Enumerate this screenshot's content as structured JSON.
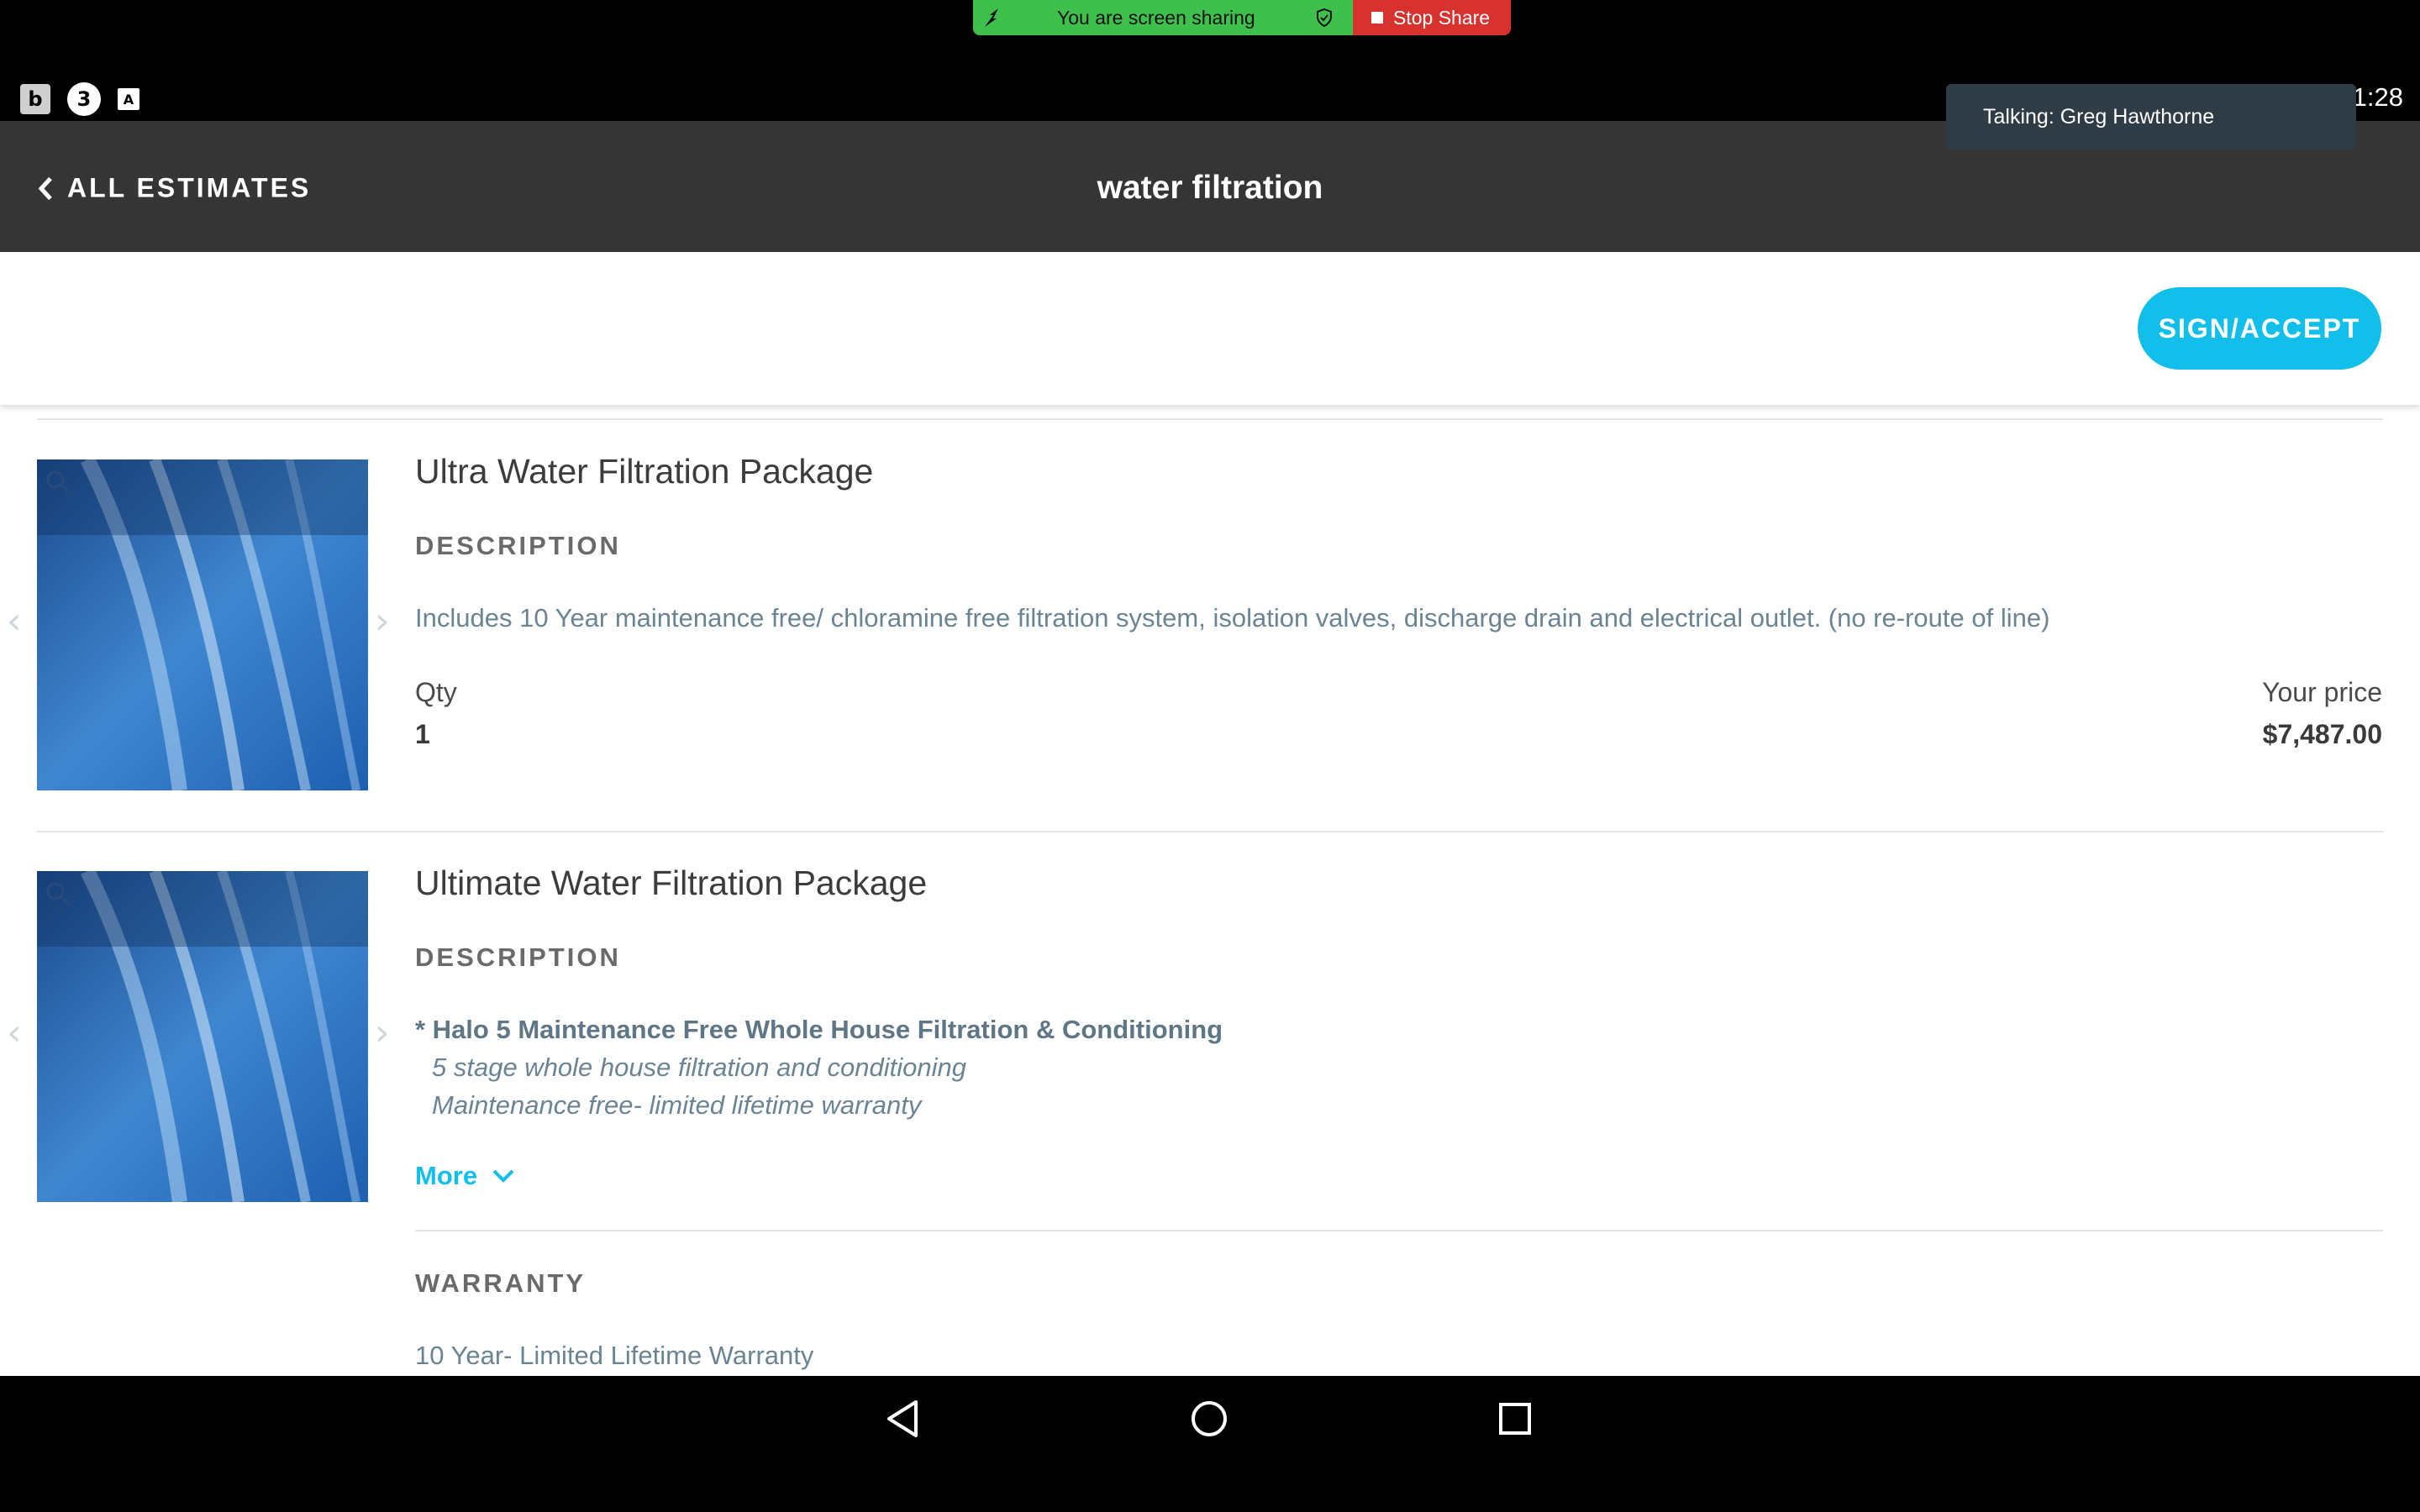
{
  "screen_share": {
    "status_text": "You are screen sharing",
    "stop_label": "Stop Share"
  },
  "status_bar": {
    "icons": [
      "b",
      "3",
      "A"
    ],
    "clock": "1:28"
  },
  "talking_toast": "Talking: Greg Hawthorne",
  "header": {
    "back_label": "ALL ESTIMATES",
    "title": "water filtration"
  },
  "actions": {
    "sign_label": "SIGN/ACCEPT"
  },
  "items": [
    {
      "title": "Ultra Water Filtration Package",
      "description_label": "DESCRIPTION",
      "description": "Includes 10 Year maintenance free/ chloramine free filtration system, isolation valves, discharge drain and electrical outlet. (no re-route of line)",
      "qty_label": "Qty",
      "qty": "1",
      "price_label": "Your price",
      "price": "$7,487.00"
    },
    {
      "title": "Ultimate Water Filtration Package",
      "description_label": "DESCRIPTION",
      "bullet_title": "* Halo 5 Maintenance Free Whole House Filtration & Conditioning",
      "bullet_lines": [
        "5 stage whole house filtration and conditioning",
        "Maintenance free- limited lifetime warranty"
      ],
      "more_label": "More",
      "warranty_label": "WARRANTY",
      "warranty": "10 Year- Limited Lifetime Warranty"
    }
  ],
  "colors": {
    "accent": "#11bfea",
    "header_bg": "#353535",
    "share_green": "#3fbf4b",
    "share_red": "#d8322f"
  }
}
